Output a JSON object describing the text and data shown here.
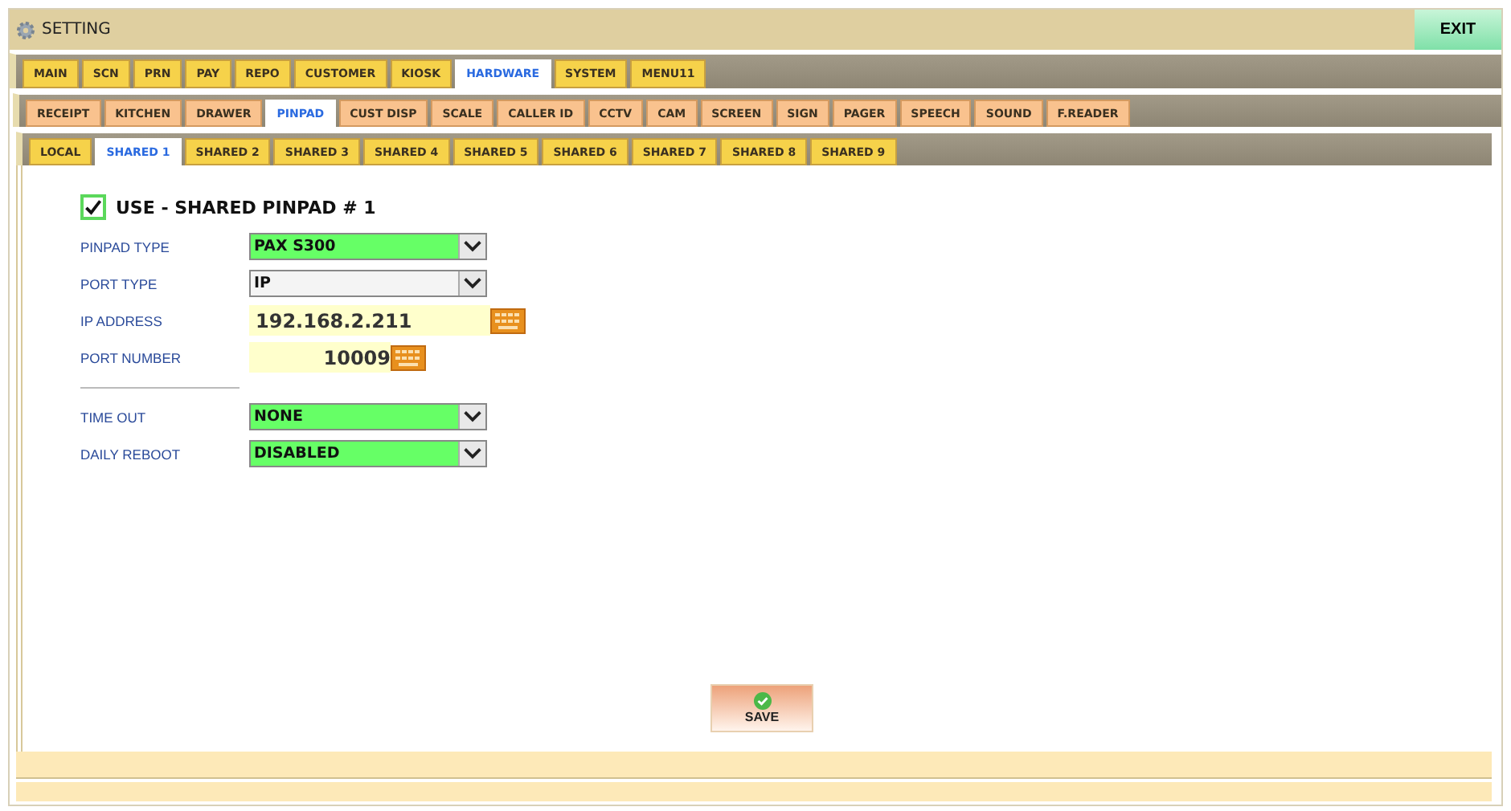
{
  "window": {
    "title": "SETTING",
    "exit": "EXIT"
  },
  "tabs": [
    {
      "label": "MAIN",
      "selected": false
    },
    {
      "label": "SCN",
      "selected": false
    },
    {
      "label": "PRN",
      "selected": false
    },
    {
      "label": "PAY",
      "selected": false
    },
    {
      "label": "REPO",
      "selected": false
    },
    {
      "label": "CUSTOMER",
      "selected": false
    },
    {
      "label": "KIOSK",
      "selected": false
    },
    {
      "label": "HARDWARE",
      "selected": true
    },
    {
      "label": "SYSTEM",
      "selected": false
    },
    {
      "label": "MENU11",
      "selected": false
    }
  ],
  "subtabs": [
    {
      "label": "RECEIPT",
      "selected": false
    },
    {
      "label": "KITCHEN",
      "selected": false
    },
    {
      "label": "DRAWER",
      "selected": false
    },
    {
      "label": "PINPAD",
      "selected": true
    },
    {
      "label": "CUST DISP",
      "selected": false
    },
    {
      "label": "SCALE",
      "selected": false
    },
    {
      "label": "CALLER ID",
      "selected": false
    },
    {
      "label": "CCTV",
      "selected": false
    },
    {
      "label": "CAM",
      "selected": false
    },
    {
      "label": "SCREEN",
      "selected": false
    },
    {
      "label": "SIGN",
      "selected": false
    },
    {
      "label": "PAGER",
      "selected": false
    },
    {
      "label": "SPEECH",
      "selected": false
    },
    {
      "label": "SOUND",
      "selected": false
    },
    {
      "label": "F.READER",
      "selected": false
    }
  ],
  "pinpad_tabs": [
    {
      "label": "LOCAL",
      "selected": false
    },
    {
      "label": "SHARED 1",
      "selected": true
    },
    {
      "label": "SHARED 2",
      "selected": false
    },
    {
      "label": "SHARED 3",
      "selected": false
    },
    {
      "label": "SHARED 4",
      "selected": false
    },
    {
      "label": "SHARED 5",
      "selected": false
    },
    {
      "label": "SHARED 6",
      "selected": false
    },
    {
      "label": "SHARED 7",
      "selected": false
    },
    {
      "label": "SHARED 8",
      "selected": false
    },
    {
      "label": "SHARED 9",
      "selected": false
    }
  ],
  "use": {
    "label": "USE - SHARED PINPAD # 1",
    "checked": true
  },
  "groups": [
    [
      {
        "label": "PINPAD TYPE",
        "kind": "select",
        "value": "PAX S300",
        "highlighted": true
      },
      {
        "label": "PORT TYPE",
        "kind": "select",
        "value": "IP",
        "highlighted": false
      },
      {
        "label": "IP ADDRESS",
        "kind": "text",
        "value": "192.168.2.211"
      },
      {
        "label": "PORT NUMBER",
        "kind": "number",
        "value": "10009"
      }
    ],
    [
      {
        "label": "TIME OUT",
        "kind": "select",
        "value": "NONE",
        "highlighted": true
      },
      {
        "label": "DAILY REBOOT",
        "kind": "select",
        "value": "DISABLED",
        "highlighted": true
      }
    ]
  ],
  "save": "SAVE"
}
